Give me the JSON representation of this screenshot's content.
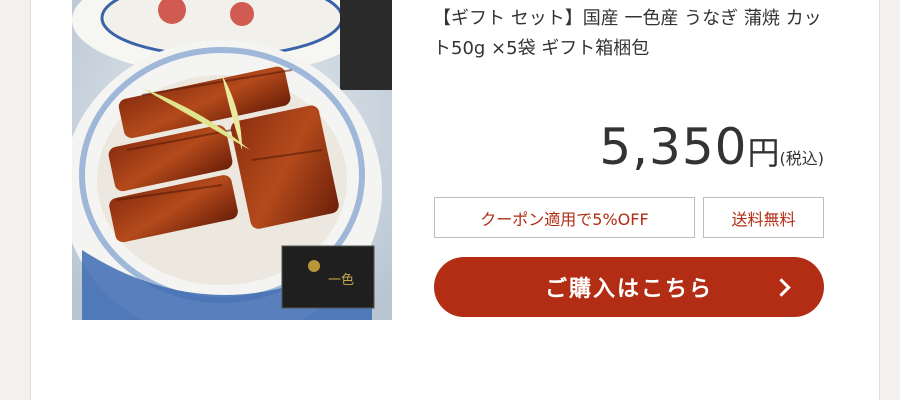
{
  "product": {
    "image_alt": "うなぎ蒲焼丼",
    "title": "【ギフト セット】国産 一色産 うなぎ 蒲焼 カット50g ×5袋 ギフト箱梱包",
    "price": {
      "value": "5,350",
      "unit": "円",
      "tax_note": "(税込)"
    },
    "badges": {
      "coupon": "クーポン適用で5%OFF",
      "shipping": "送料無料"
    },
    "buy_button_label": "ご購入はこちら",
    "box_logo_text": "一色"
  },
  "colors": {
    "accent": "#b22d14",
    "text": "#333333",
    "border": "#bdbdbd"
  },
  "icons": {
    "buy_arrow": "chevron-right-icon"
  }
}
